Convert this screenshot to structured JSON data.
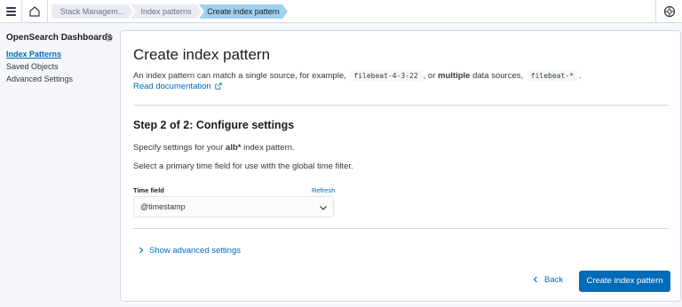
{
  "header": {
    "breadcrumbs": [
      "Stack Managem...",
      "Index patterns",
      "Create index pattern"
    ],
    "icons": {
      "menu": "hamburger-icon",
      "home": "home-icon",
      "help": "help-icon"
    }
  },
  "sidebar": {
    "title": "OpenSearch Dashboards",
    "items": [
      {
        "label": "Index Patterns",
        "active": true
      },
      {
        "label": "Saved Objects",
        "active": false
      },
      {
        "label": "Advanced Settings",
        "active": false
      }
    ]
  },
  "main": {
    "title": "Create index pattern",
    "description": {
      "part1": "An index pattern can match a single source, for example,",
      "example1": "filebeat-4-3-22",
      "part2": ", or",
      "bold": "multiple",
      "part3": "data sources,",
      "example2": "filebeat-*",
      "part4": "."
    },
    "doc_link": "Read documentation",
    "step_title": "Step 2 of 2: Configure settings",
    "specify": {
      "prefix": "Specify settings for your",
      "pattern": "alb*",
      "suffix": "index pattern."
    },
    "time_hint": "Select a primary time field for use with the global time filter.",
    "time_field": {
      "label": "Time field",
      "refresh": "Refresh",
      "value": "@timestamp"
    },
    "advanced": "Show advanced settings",
    "back": "Back",
    "create_button": "Create index pattern"
  },
  "colors": {
    "primary": "#006bb8",
    "active_crumb": "#9fd0ef",
    "border": "#d3dae6"
  }
}
